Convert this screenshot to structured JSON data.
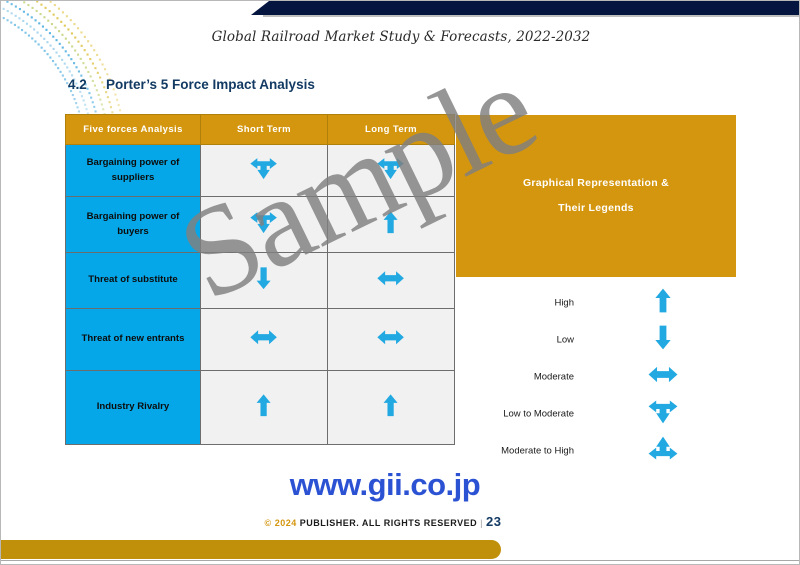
{
  "header": {
    "doc_title": "Global Railroad Market Study & Forecasts, 2022-2032"
  },
  "section": {
    "number": "4.2",
    "title": "Porter’s 5 Force Impact Analysis"
  },
  "table": {
    "columns": [
      "Five forces Analysis",
      "Short Term",
      "Long Term"
    ],
    "rows": [
      {
        "label": "Bargaining power of suppliers",
        "short_term": "low-to-moderate-arrow-icon",
        "long_term": "low-to-moderate-arrow-icon"
      },
      {
        "label": "Bargaining power of buyers",
        "short_term": "low-to-moderate-arrow-icon",
        "long_term": "up-arrow-icon"
      },
      {
        "label": "Threat of substitute",
        "short_term": "down-arrow-icon",
        "long_term": "left-right-arrow-icon"
      },
      {
        "label": "Threat of new entrants",
        "short_term": "left-right-arrow-icon",
        "long_term": "left-right-arrow-icon"
      },
      {
        "label": "Industry Rivalry",
        "short_term": "up-arrow-icon",
        "long_term": "up-arrow-icon"
      }
    ]
  },
  "legend_box": {
    "line1": "Graphical Representation &",
    "line2": "Their Legends"
  },
  "legend": {
    "items": [
      {
        "label": "High",
        "icon": "up-arrow-icon"
      },
      {
        "label": "Low",
        "icon": "down-arrow-icon"
      },
      {
        "label": "Moderate",
        "icon": "left-right-arrow-icon"
      },
      {
        "label": "Low to Moderate",
        "icon": "low-to-moderate-arrow-icon"
      },
      {
        "label": "Moderate to High",
        "icon": "moderate-to-high-arrow-icon"
      }
    ]
  },
  "watermark": {
    "text": "Sample"
  },
  "footer": {
    "url": "www.gii.co.jp",
    "copyright_symbol": "©",
    "year": "2024",
    "rights": "PUBLISHER. ALL RIGHTS RESERVED",
    "separator": "|",
    "page_number": "23"
  },
  "colors": {
    "orange": "#D4960E",
    "cyan": "#06A7E8",
    "navy": "#041540",
    "arrow_blue": "#23A9E2",
    "link_blue": "#2c52d4",
    "gold_band": "#C1900A"
  }
}
